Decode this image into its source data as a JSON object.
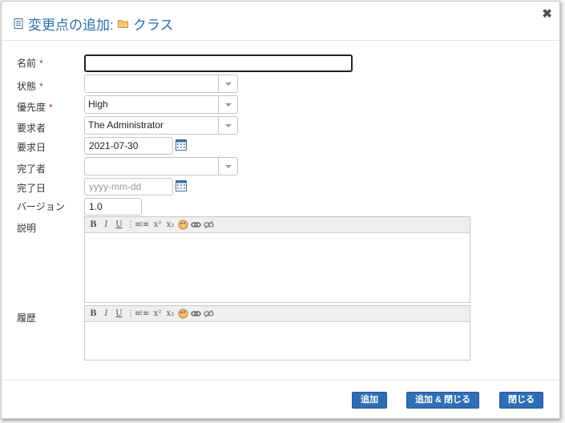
{
  "dialog": {
    "title": "変更点の追加:",
    "title_object": "クラス",
    "close_glyph": "✖"
  },
  "form": {
    "name": {
      "label": "名前",
      "required_mark": "*",
      "value": ""
    },
    "status": {
      "label": "状態",
      "required_mark": "*",
      "value": ""
    },
    "priority": {
      "label": "優先度",
      "required_mark": "*",
      "value": "High"
    },
    "requester": {
      "label": "要求者",
      "value": "The Administrator"
    },
    "request_date": {
      "label": "要求日",
      "value": "2021-07-30"
    },
    "completed_by": {
      "label": "完了者",
      "value": ""
    },
    "completed_date": {
      "label": "完了日",
      "value": "",
      "placeholder": "yyyy-mm-dd"
    },
    "version": {
      "label": "バージョン",
      "value": "1.0"
    },
    "description": {
      "label": "説明",
      "value": ""
    },
    "history": {
      "label": "履歴",
      "value": ""
    }
  },
  "toolbar": {
    "bold": "B",
    "italic": "I",
    "underline": "U",
    "ordered_list": "⋮≡",
    "unordered_list": "⁝≡",
    "superscript": "x²",
    "subscript": "x₂"
  },
  "buttons": {
    "add": "追加",
    "add_close": "追加 & 閉じる",
    "close": "閉じる"
  },
  "colors": {
    "title": "#2d6fa8",
    "button": "#2f6eb5",
    "required": "#c0392b"
  }
}
